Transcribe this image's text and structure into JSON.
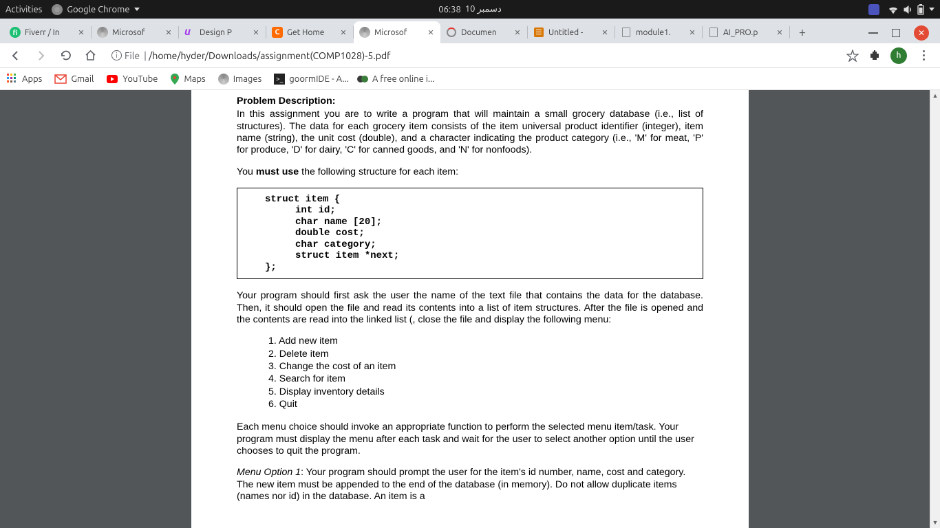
{
  "topbar": {
    "activities": "Activities",
    "app": "Google Chrome",
    "clock": "06:38",
    "date": "دسمبر 10"
  },
  "tabs": [
    {
      "title": "Fiverr / In"
    },
    {
      "title": "Microsof"
    },
    {
      "title": "Design P"
    },
    {
      "title": "Get Home"
    },
    {
      "title": "Microsof"
    },
    {
      "title": "Documen"
    },
    {
      "title": "Untitled -"
    },
    {
      "title": "module1."
    },
    {
      "title": "AI_PRO.p"
    }
  ],
  "url": {
    "scheme": "File",
    "sep": "|",
    "path": "/home/hyder/Downloads/assignment(COMP1028)-5.pdf"
  },
  "bookmarks": [
    {
      "label": "Apps"
    },
    {
      "label": "Gmail"
    },
    {
      "label": "YouTube"
    },
    {
      "label": "Maps"
    },
    {
      "label": "Images"
    },
    {
      "label": "goormIDE - A..."
    },
    {
      "label": "A free online i..."
    }
  ],
  "avatar": "h",
  "doc": {
    "heading": "Problem Description:",
    "p1": "In this assignment you are to write a program that will maintain a small grocery database (i.e., list of structures). The data for each grocery item consists of the item universal product identifier (integer), item name (string), the unit cost (double), and a character indicating the product category (i.e., 'M' for meat, 'P' for produce, 'D' for dairy, 'C' for canned goods, and 'N' for nonfoods).",
    "p2a": "You ",
    "p2b": "must use",
    "p2c": " the following structure for each item:",
    "code": {
      "l1": "struct item {",
      "l2": "int id;",
      "l3": "char name [20];",
      "l4": "double cost;",
      "l5": "char category;",
      "l6": "struct item *next;",
      "l7": "};"
    },
    "p3": "Your program should first ask the user the name of the text file that contains the data for the database.  Then, it should open the file and read its contents into a list of item structures. After the file is opened and the contents are read into the linked list (, close the file and display the following menu:",
    "menu": [
      "1.  Add new item",
      "2.  Delete item",
      "3.  Change the cost of an item",
      "4.  Search for item",
      "5.  Display inventory details",
      "6.  Quit"
    ],
    "p4": "Each menu choice should invoke an appropriate function to perform the selected menu item/task.  Your program must display the menu after each task and wait for the user to select another option until the user chooses to quit the program.",
    "p5a": "Menu Option 1",
    "p5b": ":  Your program should prompt the user for the item's id number, name, cost and category.  The new item must be appended to the end of the database (in memory).  Do not allow duplicate items (names nor id) in the database. An item is a"
  }
}
